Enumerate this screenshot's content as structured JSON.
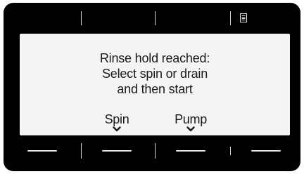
{
  "top_bar": {
    "menu_icon": "list-menu-icon"
  },
  "display": {
    "message_lines": [
      "Rinse hold reached:",
      "Select spin or drain",
      "and then start"
    ],
    "options": [
      {
        "label": "Spin",
        "icon": "chevron-down-icon"
      },
      {
        "label": "Pump",
        "icon": "chevron-down-icon"
      }
    ]
  },
  "colors": {
    "bezel": "#000000",
    "screen": "#f4f4f4",
    "text": "#1a1a1a",
    "divider": "#d8d8d8"
  }
}
